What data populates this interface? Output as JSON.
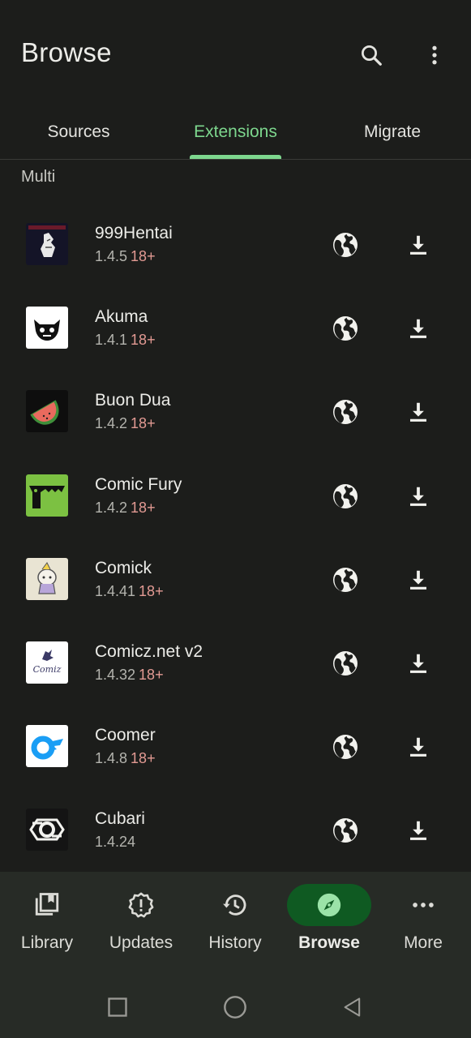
{
  "header": {
    "title": "Browse",
    "search_icon": "search-icon",
    "menu_icon": "more-vert-icon"
  },
  "tabs": [
    {
      "label": "Sources",
      "active": false
    },
    {
      "label": "Extensions",
      "active": true
    },
    {
      "label": "Migrate",
      "active": false
    }
  ],
  "section": {
    "title": "Multi"
  },
  "extensions": [
    {
      "name": "999Hentai",
      "version": "1.4.5",
      "nsfw": "18+",
      "icon": "999hentai-logo"
    },
    {
      "name": "Akuma",
      "version": "1.4.1",
      "nsfw": "18+",
      "icon": "akuma-logo"
    },
    {
      "name": "Buon Dua",
      "version": "1.4.2",
      "nsfw": "18+",
      "icon": "watermelon-logo"
    },
    {
      "name": "Comic Fury",
      "version": "1.4.2",
      "nsfw": "18+",
      "icon": "comicfury-logo"
    },
    {
      "name": "Comick",
      "version": "1.4.41",
      "nsfw": "18+",
      "icon": "comick-logo"
    },
    {
      "name": "Comicz.net v2",
      "version": "1.4.32",
      "nsfw": "18+",
      "icon": "comicz-logo"
    },
    {
      "name": "Coomer",
      "version": "1.4.8",
      "nsfw": "18+",
      "icon": "coomer-logo"
    },
    {
      "name": "Cubari",
      "version": "1.4.24",
      "nsfw": "",
      "icon": "cubari-logo"
    }
  ],
  "bottom_nav": [
    {
      "label": "Library",
      "icon": "library-icon",
      "active": false
    },
    {
      "label": "Updates",
      "icon": "updates-icon",
      "active": false
    },
    {
      "label": "History",
      "icon": "history-icon",
      "active": false
    },
    {
      "label": "Browse",
      "icon": "compass-icon",
      "active": true
    },
    {
      "label": "More",
      "icon": "more-horiz-icon",
      "active": false
    }
  ],
  "colors": {
    "background": "#1c1d1b",
    "accent": "#7dd78e",
    "active_pill": "#0f5a22",
    "nsfw": "#e29a93",
    "nav_bg": "#272b26"
  }
}
